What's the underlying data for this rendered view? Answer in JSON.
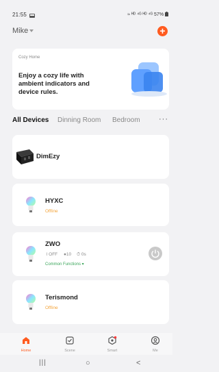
{
  "status_bar": {
    "time": "21:55",
    "indicators": "≈ ᴴᴰ ⁴ᴳ ᴴᴰ ⁴ᴳ 57%",
    "notification_icon": "gallery-icon",
    "battery_icon": "battery-icon"
  },
  "header": {
    "home_name": "Mike",
    "add_icon": "plus",
    "add_label": "+"
  },
  "banner": {
    "label": "Cozy Home",
    "text": "Enjoy a cozy life with ambient indicators and device rules.",
    "page_count": 2,
    "active_page": 1
  },
  "tabs": {
    "items": [
      "All Devices",
      "Dinning Room",
      "Bedroom"
    ],
    "active": "All Devices",
    "more": "···"
  },
  "devices": [
    {
      "name": "DimEzy",
      "icon": "dimmer-icon"
    },
    {
      "name": "HYXC",
      "status": "Offline",
      "icon": "bulb-icon"
    },
    {
      "name": "ZWO",
      "power_state": "⏽OFF",
      "brightness": "●10",
      "timer": "⏱ 0s",
      "functions_label": "Common Functions ▾",
      "icon": "bulb-icon"
    },
    {
      "name": "Terismond",
      "status": "Offline",
      "icon": "bulb-icon"
    }
  ],
  "bottom_nav": [
    {
      "label": "Home",
      "icon": "home-icon",
      "active": true
    },
    {
      "label": "Scene",
      "icon": "scene-icon",
      "active": false
    },
    {
      "label": "Smart",
      "icon": "smart-icon",
      "active": false
    },
    {
      "label": "Me",
      "icon": "profile-icon",
      "active": false
    }
  ],
  "system_nav": {
    "recents": "|||",
    "home": "○",
    "back": "<"
  },
  "colors": {
    "accent": "#ff5b1f",
    "offline": "#f3a43b",
    "functions": "#3aa55a",
    "background": "#f2f2f4"
  }
}
